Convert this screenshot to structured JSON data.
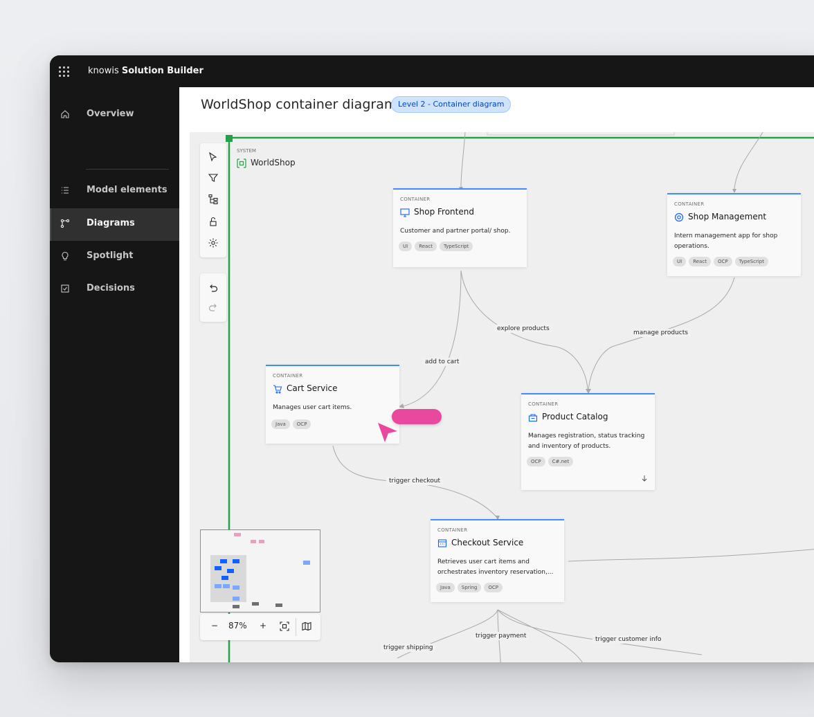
{
  "app": {
    "brand_prefix": "knowis",
    "brand_name": "Solution Builder"
  },
  "sidebar": {
    "items": [
      {
        "label": "Overview",
        "icon": "home-icon",
        "active": false
      },
      {
        "label": "Model elements",
        "icon": "list-icon",
        "active": false
      },
      {
        "label": "Diagrams",
        "icon": "diagram-icon",
        "active": true
      },
      {
        "label": "Spotlight",
        "icon": "lightbulb-icon",
        "active": false
      },
      {
        "label": "Decisions",
        "icon": "checkbox-icon",
        "active": false
      }
    ]
  },
  "header": {
    "title": "WorldShop container diagram",
    "badge": "Level 2 - Container diagram"
  },
  "system": {
    "kind": "SYSTEM",
    "name": "WorldShop"
  },
  "containers": {
    "shop_frontend": {
      "kind": "CONTAINER",
      "name": "Shop Frontend",
      "desc": "Customer and partner portal/ shop.",
      "tags": [
        "UI",
        "React",
        "TypeScript"
      ]
    },
    "shop_management": {
      "kind": "CONTAINER",
      "name": "Shop Management",
      "desc": "Intern management app for shop operations.",
      "tags": [
        "UI",
        "React",
        "OCP",
        "TypeScript"
      ]
    },
    "cart_service": {
      "kind": "CONTAINER",
      "name": "Cart Service",
      "desc": "Manages user cart items.",
      "tags": [
        "Java",
        "OCP"
      ]
    },
    "product_catalog": {
      "kind": "CONTAINER",
      "name": "Product Catalog",
      "desc": "Manages registration, status tracking and inventory of products.",
      "tags": [
        "OCP",
        "C#.net"
      ]
    },
    "checkout_service": {
      "kind": "CONTAINER",
      "name": "Checkout Service",
      "desc": "Retrieves user cart items and orchestrates inventory reservation,...",
      "tags": [
        "Java",
        "Spring",
        "OCP"
      ]
    }
  },
  "edges": {
    "explore_products": "explore products",
    "manage_products": "manage products",
    "add_to_cart": "add to cart",
    "trigger_checkout": "trigger checkout",
    "trigger_shipping": "trigger shipping",
    "trigger_payment": "trigger payment",
    "trigger_customer_info": "trigger customer info"
  },
  "zoom": {
    "minus": "−",
    "level": "87%",
    "plus": "+"
  },
  "colors": {
    "accent": "#4589ff",
    "system_border": "#24a148",
    "highlight": "#e9489f",
    "sidebar_bg": "#161616"
  }
}
